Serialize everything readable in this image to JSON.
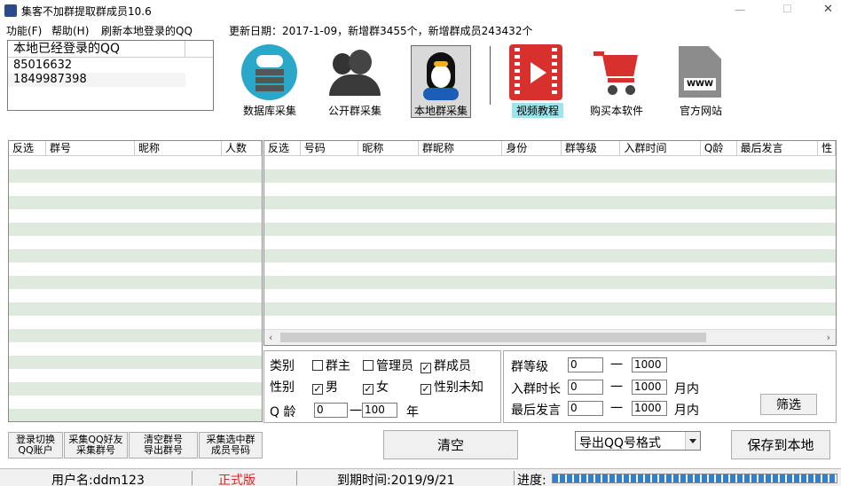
{
  "window": {
    "title": "集客不加群提取群成员10.6",
    "minimize": "—",
    "maximize": "☐",
    "close": "✕"
  },
  "menu": [
    "功能(F)",
    "帮助(H)",
    "刷新本地登录的QQ"
  ],
  "update_notice": "更新日期：2017-1-09，新增群3455个，新增群成员243432个",
  "logged_in": {
    "header": "本地已经登录的QQ",
    "accounts": [
      "85016632",
      "1849987398"
    ]
  },
  "toolbar": [
    {
      "label": "数据库采集",
      "icon": "database-cloud-icon"
    },
    {
      "label": "公开群采集",
      "icon": "people-icon"
    },
    {
      "label": "本地群采集",
      "icon": "qq-penguin-icon"
    },
    {
      "label": "视频教程",
      "icon": "video-icon"
    },
    {
      "label": "购买本软件",
      "icon": "cart-icon"
    },
    {
      "label": "官方网站",
      "icon": "website-file-icon"
    }
  ],
  "toolbar_sample_text": "WWW",
  "group_table": {
    "columns": [
      "反选",
      "群号",
      "昵称",
      "人数"
    ]
  },
  "member_table": {
    "columns": [
      "反选",
      "号码",
      "昵称",
      "群昵称",
      "身份",
      "群等级",
      "入群时间",
      "Q龄",
      "最后发言",
      "性"
    ]
  },
  "filters": {
    "category_label": "类别",
    "category_options": [
      {
        "label": "群主",
        "checked": false
      },
      {
        "label": "管理员",
        "checked": false
      },
      {
        "label": "群成员",
        "checked": true
      }
    ],
    "gender_label": "性别",
    "gender_options": [
      {
        "label": "男",
        "checked": true
      },
      {
        "label": "女",
        "checked": true
      },
      {
        "label": "性别未知",
        "checked": true
      }
    ],
    "qage_label": "Q 龄",
    "qage_from": "0",
    "qage_dash": "一",
    "qage_to": "100",
    "qage_unit": "年",
    "level_label": "群等级",
    "level_from": "0",
    "level_dash": "一",
    "level_to": "1000",
    "join_label": "入群时长",
    "join_from": "0",
    "join_dash": "一",
    "join_to": "1000",
    "join_unit": "月内",
    "last_label": "最后发言",
    "last_from": "0",
    "last_dash": "一",
    "last_to": "1000",
    "last_unit": "月内",
    "filter_button": "筛选"
  },
  "actions": {
    "login_switch": "登录切换",
    "qq_account": "QQ账户",
    "collect_friends": "采集QQ好友",
    "collect_groups": "采集群号",
    "clear_groups": "清空群号",
    "export_groups": "导出群号",
    "collect_selected": "采集选中群",
    "member_numbers": "成员号码",
    "clear": "清空",
    "export_format": "导出QQ号格式",
    "save_local": "保存到本地"
  },
  "status": {
    "username": "用户名:ddm123",
    "edition": "正式版",
    "expire": "到期时间:2019/9/21",
    "progress_label": "进度:",
    "progress": 1.0
  },
  "colors": {
    "edition_red": "#e02020",
    "row_stripe": "#dfeadf",
    "progress_blue": "#2e7fd6"
  }
}
